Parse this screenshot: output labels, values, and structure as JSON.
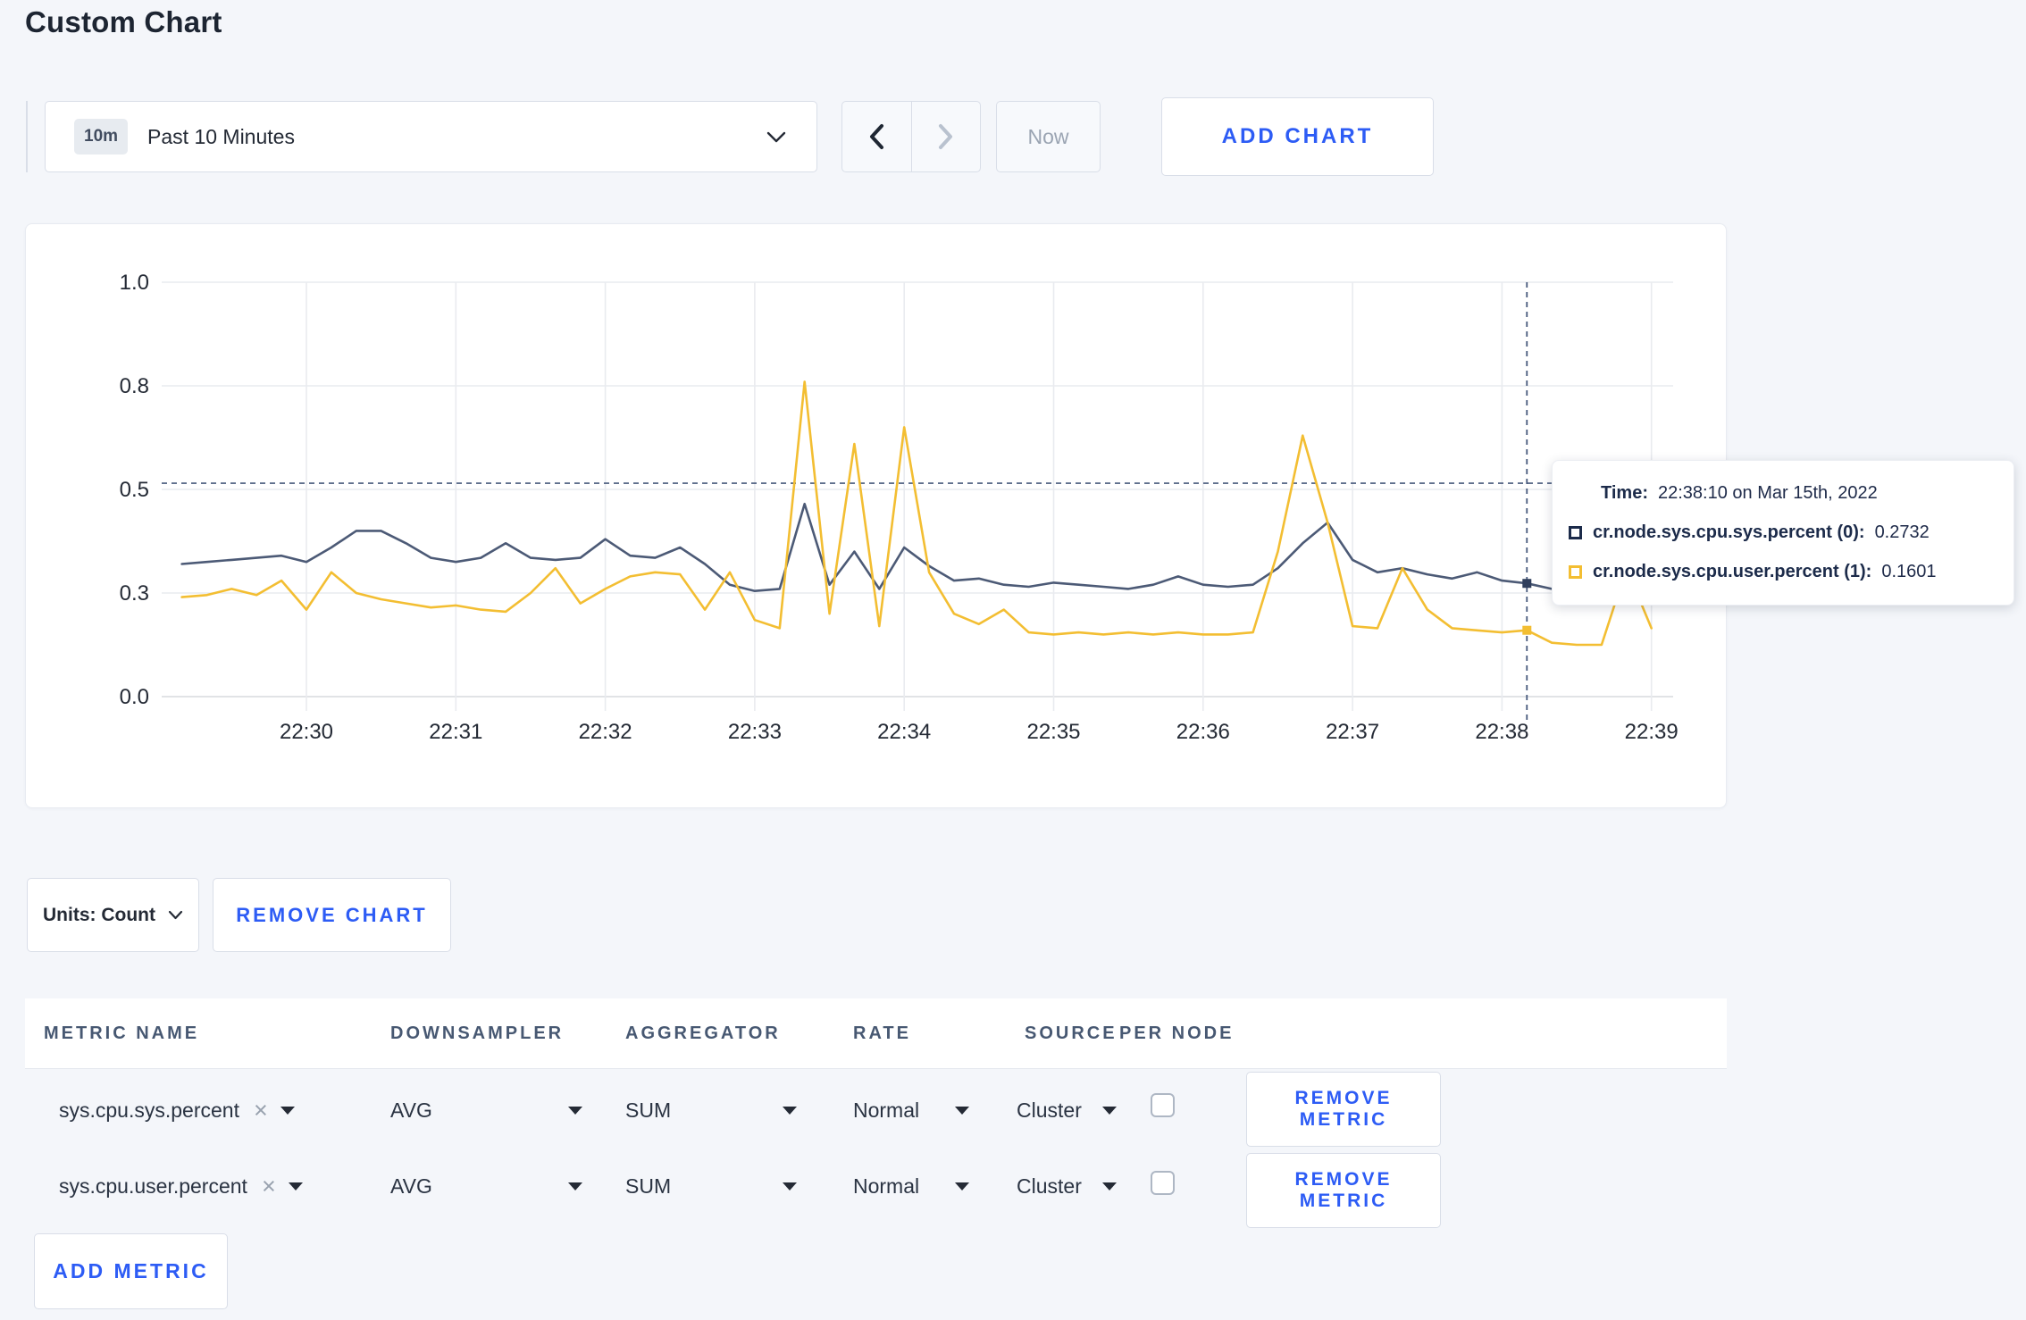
{
  "page": {
    "title": "Custom Chart",
    "background": "#f4f6fa",
    "accent_blue": "#2d5cf5"
  },
  "toolbar": {
    "time_window_badge": "10m",
    "time_window_label": "Past 10 Minutes",
    "now_label": "Now",
    "add_chart_label": "ADD CHART"
  },
  "chart_footer": {
    "units_label": "Units: Count",
    "remove_chart_label": "REMOVE CHART"
  },
  "tooltip": {
    "time_label": "Time:",
    "time_value": "22:38:10 on Mar 15th, 2022",
    "rows": [
      {
        "swatch_color": "#1c2b4a",
        "name": "cr.node.sys.cpu.sys.percent (0):",
        "value": "0.2732"
      },
      {
        "swatch_color": "#f3be32",
        "name": "cr.node.sys.cpu.user.percent (1):",
        "value": "0.1601"
      }
    ]
  },
  "chart_data": {
    "type": "line",
    "title": "",
    "xlabel": "",
    "ylabel": "",
    "ylim": [
      0,
      1
    ],
    "grid": true,
    "legend_position": "none",
    "x_tick_labels": [
      "22:30",
      "22:31",
      "22:32",
      "22:33",
      "22:34",
      "22:35",
      "22:36",
      "22:37",
      "22:38",
      "22:39"
    ],
    "y_ticks": [
      {
        "v": 0,
        "label": "0.0"
      },
      {
        "v": 0.25,
        "label": "0.3"
      },
      {
        "v": 0.5,
        "label": "0.5"
      },
      {
        "v": 0.75,
        "label": "0.8"
      },
      {
        "v": 1,
        "label": "1.0"
      }
    ],
    "start_time": "22:29:10",
    "interval_seconds": 10,
    "series": [
      {
        "name": "cr.node.sys.cpu.sys.percent",
        "color": "#4c5a76",
        "values": [
          0.32,
          0.325,
          0.33,
          0.335,
          0.34,
          0.325,
          0.36,
          0.4,
          0.4,
          0.37,
          0.335,
          0.325,
          0.335,
          0.37,
          0.335,
          0.33,
          0.335,
          0.38,
          0.34,
          0.335,
          0.36,
          0.32,
          0.27,
          0.255,
          0.26,
          0.465,
          0.27,
          0.35,
          0.26,
          0.36,
          0.315,
          0.28,
          0.285,
          0.27,
          0.265,
          0.275,
          0.27,
          0.265,
          0.26,
          0.27,
          0.29,
          0.27,
          0.265,
          0.27,
          0.31,
          0.37,
          0.42,
          0.33,
          0.3,
          0.31,
          0.295,
          0.285,
          0.3,
          0.28,
          0.2732,
          0.26,
          0.27,
          0.3,
          0.31,
          0.295
        ]
      },
      {
        "name": "cr.node.sys.cpu.user.percent",
        "color": "#f3be32",
        "values": [
          0.24,
          0.245,
          0.26,
          0.245,
          0.28,
          0.21,
          0.3,
          0.25,
          0.235,
          0.225,
          0.215,
          0.22,
          0.21,
          0.205,
          0.25,
          0.31,
          0.225,
          0.26,
          0.29,
          0.3,
          0.295,
          0.21,
          0.3,
          0.185,
          0.165,
          0.76,
          0.2,
          0.61,
          0.17,
          0.65,
          0.3,
          0.2,
          0.175,
          0.21,
          0.155,
          0.15,
          0.155,
          0.15,
          0.155,
          0.15,
          0.155,
          0.15,
          0.15,
          0.155,
          0.35,
          0.63,
          0.42,
          0.17,
          0.165,
          0.31,
          0.21,
          0.165,
          0.16,
          0.155,
          0.1601,
          0.13,
          0.125,
          0.125,
          0.31,
          0.165
        ]
      }
    ],
    "crosshair": {
      "index": 54,
      "time": "22:38:10",
      "hline_value": 0.515,
      "color": "#47597c"
    }
  },
  "metrics_table": {
    "headers": [
      "METRIC NAME",
      "DOWNSAMPLER",
      "AGGREGATOR",
      "RATE",
      "SOURCE",
      "PER NODE"
    ],
    "rows": [
      {
        "metric": "sys.cpu.sys.percent",
        "downsampler": "AVG",
        "aggregator": "SUM",
        "rate": "Normal",
        "source": "Cluster",
        "per_node_checked": false,
        "remove_label": "REMOVE METRIC"
      },
      {
        "metric": "sys.cpu.user.percent",
        "downsampler": "AVG",
        "aggregator": "SUM",
        "rate": "Normal",
        "source": "Cluster",
        "per_node_checked": false,
        "remove_label": "REMOVE METRIC"
      }
    ],
    "add_metric_label": "ADD METRIC"
  }
}
